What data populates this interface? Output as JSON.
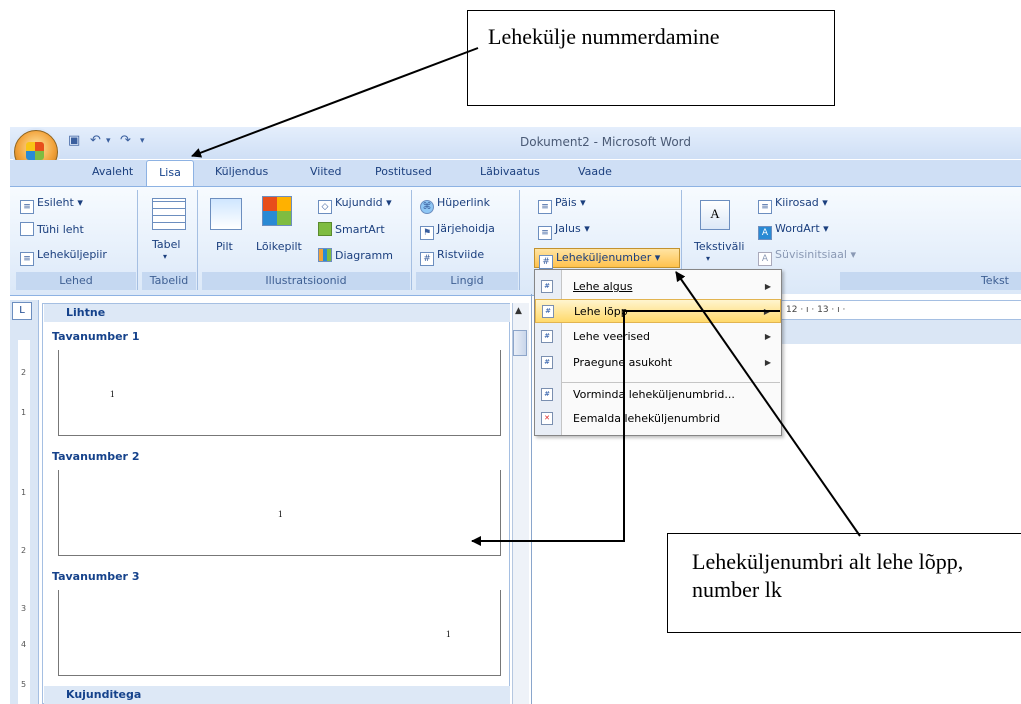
{
  "callouts": {
    "top": "Lehekülje nummerdamine",
    "bottom": "Leheküljenumbri alt lehe lõpp, number lk"
  },
  "window": {
    "title": "Dokument2 - Microsoft Word"
  },
  "tabs": [
    "Avaleht",
    "Lisa",
    "Küljendus",
    "Viited",
    "Postitused",
    "Läbivaatus",
    "Vaade"
  ],
  "ribbon": {
    "lehed": {
      "label": "Lehed",
      "items": [
        "Esileht",
        "Tühi leht",
        "Leheküljepiir"
      ]
    },
    "tabelid": {
      "label": "Tabelid",
      "table": "Tabel"
    },
    "illustratsioonid": {
      "label": "Illustratsioonid",
      "pilt": "Pilt",
      "loikepilt": "Lõikepilt",
      "kujundid": "Kujundid",
      "smartart": "SmartArt",
      "diagramm": "Diagramm"
    },
    "lingid": {
      "label": "Lingid",
      "items": [
        "Hüperlink",
        "Järjehoidja",
        "Ristviide"
      ]
    },
    "pais_jalus": {
      "pais": "Päis",
      "jalus": "Jalus",
      "leheküljenumber": "Leheküljenumber"
    },
    "tekst": {
      "label": "Tekst",
      "tekstivali": "Tekstiväli",
      "kiirosad": "Kiirosad",
      "wordart": "WordArt",
      "suvisinitsiaal": "Süvisinitsiaal"
    }
  },
  "gallery": {
    "section1": "Lihtne",
    "items": [
      {
        "title": "Tavanumber 1",
        "number": "1"
      },
      {
        "title": "Tavanumber 2",
        "number": "1"
      },
      {
        "title": "Tavanumber 3",
        "number": "1"
      }
    ],
    "section2": "Kujunditega"
  },
  "ruler": {
    "vertical": [
      "2",
      "1",
      "1",
      "2",
      "3",
      "4",
      "5"
    ],
    "horizontal": "12 · ı · 13 · ı ·",
    "corner": "L"
  },
  "dropdown": {
    "items": [
      {
        "label": "Lehe algus",
        "submenu": true
      },
      {
        "label": "Lehe lõpp",
        "submenu": true
      },
      {
        "label": "Lehe veerised",
        "submenu": true
      },
      {
        "label": "Praegune asukoht",
        "submenu": true
      },
      {
        "label": "Vorminda leheküljenumbrid...",
        "submenu": false
      },
      {
        "label": "Eemalda leheküljenumbrid",
        "submenu": false
      }
    ]
  },
  "colors": {
    "ribbon_accent": "#15428b",
    "highlight": "#ffc24d"
  }
}
